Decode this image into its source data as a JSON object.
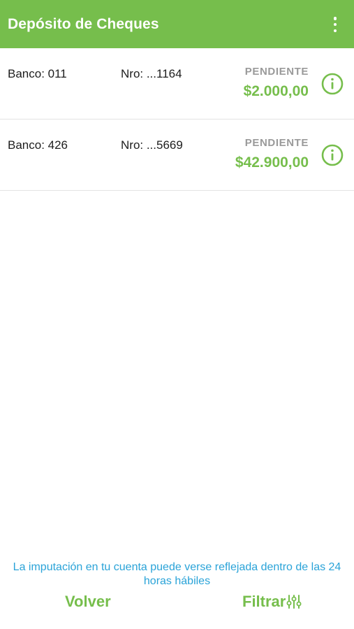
{
  "header": {
    "title": "Depósito de Cheques",
    "menu_icon": "more-vertical-icon"
  },
  "cheques": [
    {
      "bank": "Banco: 011",
      "number": "Nro: ...1164",
      "status": "PENDIENTE",
      "amount": "$2.000,00",
      "icon": "info-icon"
    },
    {
      "bank": "Banco: 426",
      "number": "Nro: ...5669",
      "status": "PENDIENTE",
      "amount": "$42.900,00",
      "icon": "info-icon"
    }
  ],
  "footer": {
    "note": "La imputación en tu cuenta puede verse reflejada dentro de las 24 horas hábiles",
    "back_label": "Volver",
    "filter_label": "Filtrar",
    "filter_icon": "filter-sliders-icon"
  },
  "colors": {
    "brand_green": "#76be4c",
    "status_gray": "#9a9a9a",
    "note_blue": "#2aa3d8"
  }
}
